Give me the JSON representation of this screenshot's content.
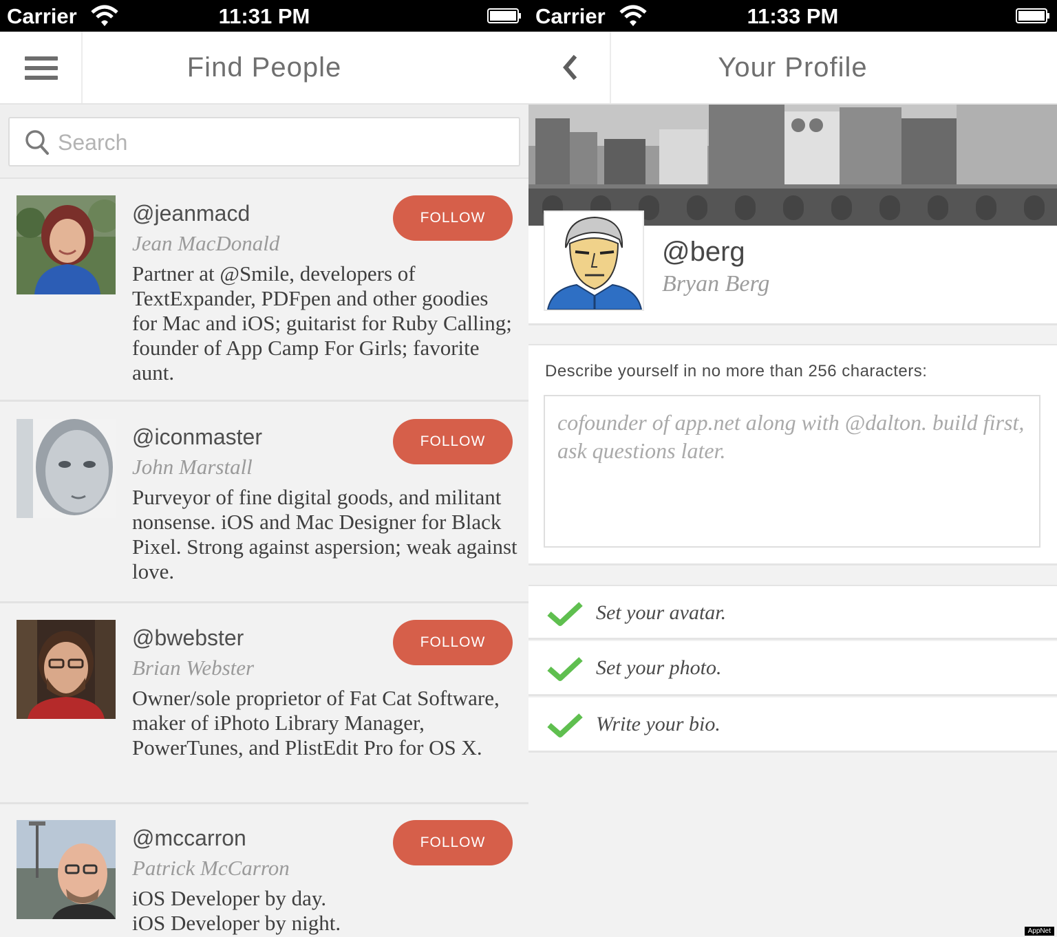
{
  "left_screen": {
    "status_bar": {
      "carrier": "Carrier",
      "time": "11:31 PM"
    },
    "nav": {
      "title": "Find People"
    },
    "search": {
      "placeholder": "Search"
    },
    "users": [
      {
        "handle": "@jeanmacd",
        "name": "Jean MacDonald",
        "follow_label": "FOLLOW",
        "bio": "Partner at @Smile, developers of TextExpander, PDFpen and other goodies for Mac and iOS; guitarist for Ruby Calling; founder of App Camp For Girls; favorite aunt."
      },
      {
        "handle": "@iconmaster",
        "name": "John Marstall",
        "follow_label": "FOLLOW",
        "bio": "Purveyor of fine digital goods, and militant nonsense. iOS and Mac Designer for Black Pixel. Strong against aspersion; weak against love."
      },
      {
        "handle": "@bwebster",
        "name": "Brian Webster",
        "follow_label": "FOLLOW",
        "bio": "Owner/sole proprietor of Fat Cat Software, maker of iPhoto Library Manager, PowerTunes, and PlistEdit Pro for OS X."
      },
      {
        "handle": "@mccarron",
        "name": "Patrick McCarron",
        "follow_label": "FOLLOW",
        "bio_line1": "iOS Developer by day.",
        "bio_line2": "iOS Developer by night."
      }
    ]
  },
  "right_screen": {
    "status_bar": {
      "carrier": "Carrier",
      "time": "11:33 PM"
    },
    "nav": {
      "title": "Your Profile"
    },
    "profile": {
      "handle": "@berg",
      "name": "Bryan Berg"
    },
    "bio_section": {
      "label": "Describe yourself in no more than 256 characters:",
      "value": "cofounder of app.net along with @dalton. build first, ask questions later."
    },
    "tasks": [
      {
        "label": "Set your avatar.",
        "done": true
      },
      {
        "label": "Set your photo.",
        "done": true
      },
      {
        "label": "Write your bio.",
        "done": true
      }
    ]
  },
  "watermark": "AppNet",
  "colors": {
    "follow": "#d65f4a",
    "check": "#5fbf4f",
    "nav_text": "#6f6f6f"
  }
}
